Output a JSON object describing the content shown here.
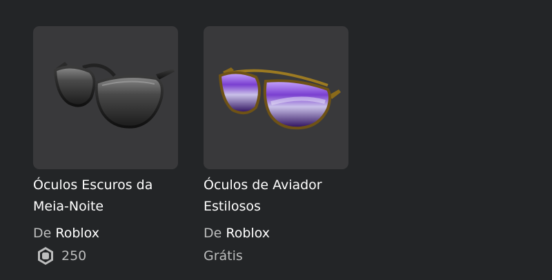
{
  "items": [
    {
      "name_line1": "Óculos Escuros da",
      "name_line2": "Meia-Noite",
      "creator_prefix": "De",
      "creator_name": "Roblox",
      "price": "250"
    },
    {
      "name_line1": "Óculos de Aviador",
      "name_line2": "Estilosos",
      "creator_prefix": "De",
      "creator_name": "Roblox",
      "price_label": "Grátis"
    }
  ],
  "icons": {
    "currency": "robux-icon"
  },
  "colors": {
    "background": "#232527",
    "card_thumb": "#39393b",
    "text_primary": "#ffffff",
    "text_secondary": "#bdbebe"
  }
}
